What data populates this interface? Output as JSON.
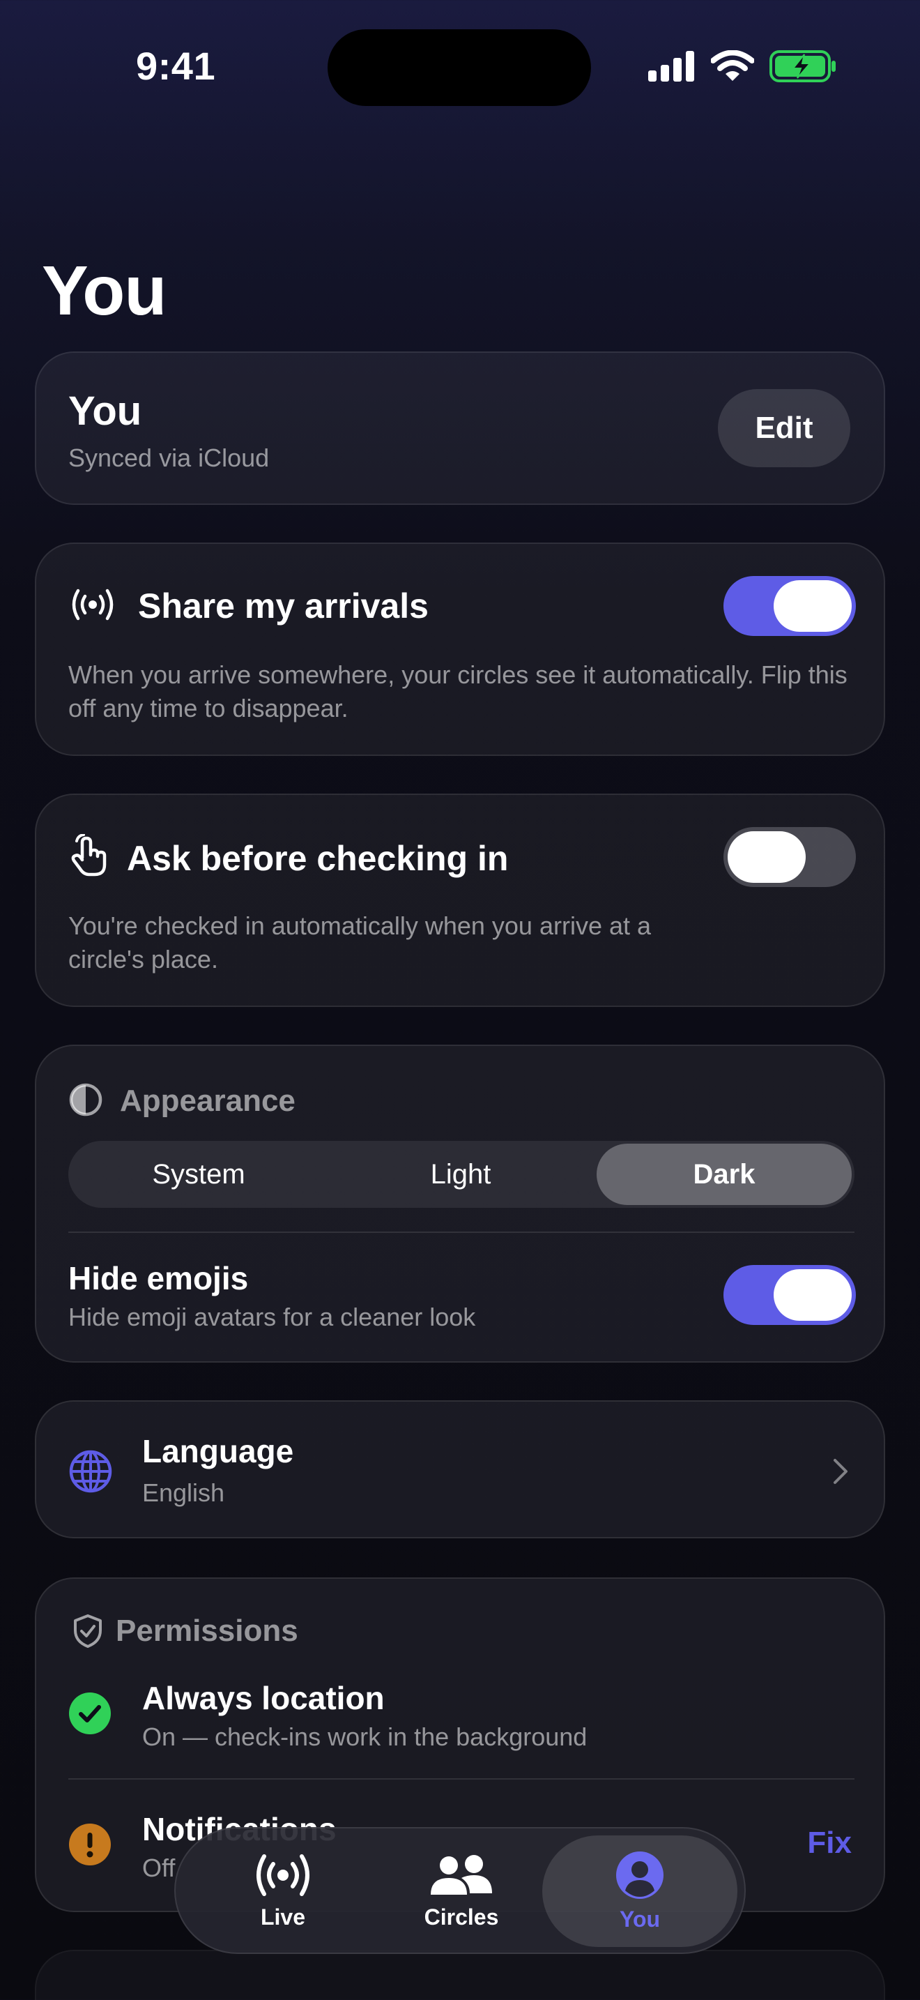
{
  "status": {
    "time": "9:41"
  },
  "page": {
    "title": "You"
  },
  "profile": {
    "name": "You",
    "sync": "Synced via iCloud",
    "edit_label": "Edit"
  },
  "share": {
    "title": "Share my arrivals",
    "desc": "When you arrive somewhere, your circles see it automatically. Flip this off any time to disappear.",
    "on": true
  },
  "ask": {
    "title": "Ask before checking in",
    "desc": "You're checked in automatically when you arrive at a circle's place.",
    "on": false
  },
  "appearance": {
    "title": "Appearance",
    "options": [
      "System",
      "Light",
      "Dark"
    ],
    "selected": "Dark",
    "hide_emojis_title": "Hide emojis",
    "hide_emojis_sub": "Hide emoji avatars for a cleaner look",
    "hide_emojis_on": true
  },
  "language": {
    "title": "Language",
    "value": "English"
  },
  "permissions": {
    "title": "Permissions",
    "location_title": "Always location",
    "location_sub": "On — check-ins work in the background",
    "notif_title": "Notifications",
    "notif_sub": "Off",
    "fix_label": "Fix"
  },
  "tabs": [
    {
      "label": "Live",
      "icon": "broadcast-icon"
    },
    {
      "label": "Circles",
      "icon": "people-icon"
    },
    {
      "label": "You",
      "icon": "person-circle-icon"
    }
  ],
  "colors": {
    "accent": "#5e5ce6",
    "success": "#30d158",
    "warning": "#c77a1e",
    "battery": "#30d158"
  }
}
